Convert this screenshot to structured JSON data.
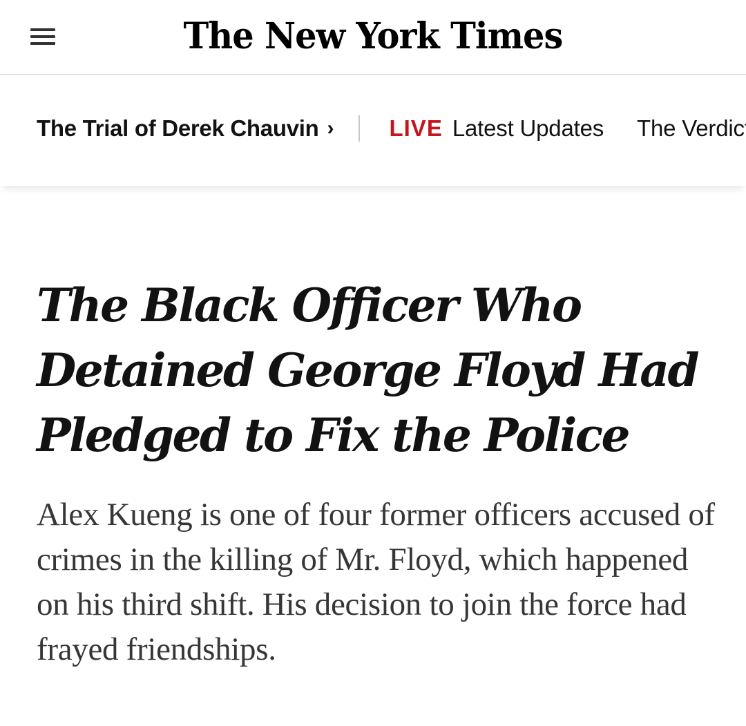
{
  "header": {
    "logo": "The New York Times",
    "menu_icon": "hamburger-menu-icon"
  },
  "subnav": {
    "section": "The Trial of Derek Chauvin",
    "chevron": "›",
    "live_label": "LIVE",
    "items": [
      {
        "label": "Latest Updates"
      },
      {
        "label": "The Verdict"
      }
    ],
    "live_color": "#c4161c"
  },
  "article": {
    "headline": "The Black Officer Who Detained George Floyd Had Pledged to Fix the Police",
    "summary": "Alex Kueng is one of four former officers accused of crimes in the killing of Mr. Floyd, which happened on his third shift. His decision to join the force had frayed friendships."
  }
}
